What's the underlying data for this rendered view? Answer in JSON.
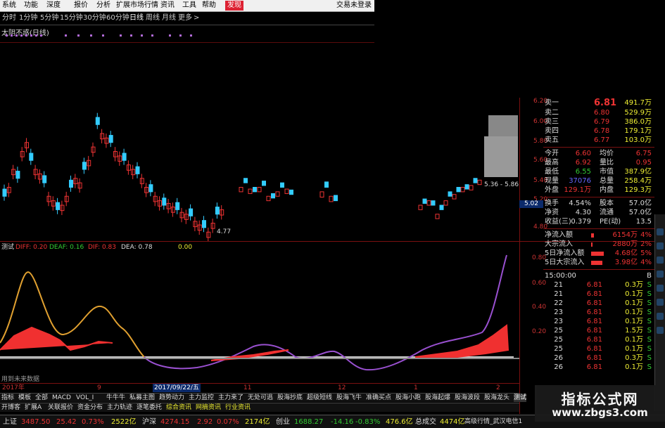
{
  "menu": {
    "items": [
      "系统",
      "功能",
      "深度",
      "报价",
      "分析",
      "扩展市场行情",
      "资讯",
      "工具",
      "帮助"
    ],
    "active": "发现",
    "login": "交易未登录"
  },
  "periods": [
    "分时",
    "1分钟",
    "5分钟",
    "15分钟",
    "30分钟",
    "60分钟",
    "日线",
    "周线",
    "月线",
    "更多",
    ">"
  ],
  "selected_period": "日线",
  "indicator_title": "太阴不惑(日线)",
  "price_axis": [
    "6.20",
    "6.00",
    "5.80",
    "5.60",
    "5.40",
    "5.20",
    "5.02",
    "4.80"
  ],
  "price_labels": {
    "low": "4.77",
    "range": "5.36 - 5.86"
  },
  "sub_indicator": {
    "name": "测试",
    "items": [
      {
        "label": "DIFF: 0.20",
        "color": "#e33"
      },
      {
        "label": "DEAF: 0.16",
        "color": "#3c3"
      },
      {
        "label": "DIF: 0.83",
        "color": "#e33"
      },
      {
        "label": "DEA: 0.78",
        "color": "#ddd"
      },
      {
        "label": "0.00",
        "color": "#ee3"
      }
    ],
    "axis": [
      "0.80",
      "0.60",
      "0.40",
      "0.20"
    ],
    "note": "用到未来数据"
  },
  "dates": [
    "2017年",
    "9",
    "2017/09/22/五",
    "11",
    "12",
    "1",
    "2"
  ],
  "tabs_row1": [
    "指标",
    "模板",
    "全部",
    "MACD",
    "VOL_I",
    "牛牛牛",
    "私募主图",
    "趋势动力",
    "主力监控",
    "主力来了",
    "无处可逃",
    "股海抄底",
    "超级短线",
    "股海飞牛",
    "准确买点",
    "股海小跑",
    "股海起爆",
    "股海波段",
    "股海龙头",
    "测试"
  ],
  "tabs_row2": [
    "开博客",
    "扩展A",
    "关联报价",
    "资金分布",
    "主力轨迹",
    "逐笔委托",
    "综合资讯",
    "网摘资讯",
    "行业资讯"
  ],
  "order_book": [
    {
      "label": "卖一",
      "price": "6.81",
      "vol": "491.7万"
    },
    {
      "label": "卖二",
      "price": "6.80",
      "vol": "529.9万"
    },
    {
      "label": "卖三",
      "price": "6.79",
      "vol": "386.0万"
    },
    {
      "label": "卖四",
      "price": "6.78",
      "vol": "179.1万"
    },
    {
      "label": "卖五",
      "price": "6.77",
      "vol": "103.0万"
    }
  ],
  "quote": [
    {
      "k1": "今开",
      "v1": "6.60",
      "k2": "均价",
      "v2": "6.75"
    },
    {
      "k1": "最高",
      "v1": "6.92",
      "k2": "量比",
      "v2": "0.95"
    },
    {
      "k1": "最低",
      "v1": "6.55",
      "k2": "市值",
      "v2": "387.9亿"
    },
    {
      "k1": "现量",
      "v1": "37076",
      "k2": "总量",
      "v2": "258.4万"
    },
    {
      "k1": "外盘",
      "v1": "129.1万",
      "k2": "内盘",
      "v2": "129.3万"
    }
  ],
  "fundamentals": [
    {
      "k1": "换手",
      "v1": "4.54%",
      "k2": "股本",
      "v2": "57.0亿"
    },
    {
      "k1": "净资",
      "v1": "4.30",
      "k2": "流通",
      "v2": "57.0亿"
    },
    {
      "k1": "收益(三)",
      "v1": "0.379",
      "k2": "PE(动)",
      "v2": "13.5"
    }
  ],
  "flows": [
    {
      "label": "净流入额",
      "value": "6154万",
      "pct": "4%"
    },
    {
      "label": "大宗流入",
      "value": "2880万",
      "pct": "2%"
    },
    {
      "label": "5日净流入额",
      "value": "4.68亿",
      "pct": "5%"
    },
    {
      "label": "5日大宗流入",
      "value": "3.98亿",
      "pct": "4%"
    }
  ],
  "ticks": {
    "header_time": "15:00:00",
    "header_type": "B",
    "rows": [
      {
        "t": "21",
        "p": "6.81",
        "v": "0.3万",
        "d": "S"
      },
      {
        "t": "21",
        "p": "6.81",
        "v": "0.1万",
        "d": "S"
      },
      {
        "t": "22",
        "p": "6.81",
        "v": "0.1万",
        "d": "S"
      },
      {
        "t": "23",
        "p": "6.81",
        "v": "0.1万",
        "d": "S"
      },
      {
        "t": "23",
        "p": "6.81",
        "v": "0.1万",
        "d": "S"
      },
      {
        "t": "25",
        "p": "6.81",
        "v": "1.5万",
        "d": "S"
      },
      {
        "t": "25",
        "p": "6.81",
        "v": "0.1万",
        "d": "S"
      },
      {
        "t": "25",
        "p": "6.81",
        "v": "0.1万",
        "d": "S"
      },
      {
        "t": "26",
        "p": "6.81",
        "v": "0.3万",
        "d": "S"
      },
      {
        "t": "26",
        "p": "6.81",
        "v": "0.1万",
        "d": "S"
      }
    ]
  },
  "status": {
    "sh_label": "上证",
    "sh_index": "3487.50",
    "sh_chg": "25.42",
    "sh_pct": "0.73%",
    "sh_amt": "2522亿",
    "hs_label": "沪深",
    "hs_index": "4274.15",
    "hs_chg": "2.92",
    "hs_pct": "0.07%",
    "hs_amt": "2174亿",
    "cy_label": "创业",
    "cy_index": "1688.27",
    "cy_chg": "-14.16",
    "cy_pct": "-0.83%",
    "cy_amt": "476.6亿",
    "total_label": "总成交",
    "total": "4474亿",
    "feed": "高级行情_武汉电信1"
  },
  "watermark": {
    "title": "指标公式网",
    "url": "www.zbgs3.com"
  },
  "chart_data": {
    "type": "line",
    "price_range": [
      4.7,
      6.3
    ],
    "indicator_range": [
      0,
      0.9
    ]
  }
}
